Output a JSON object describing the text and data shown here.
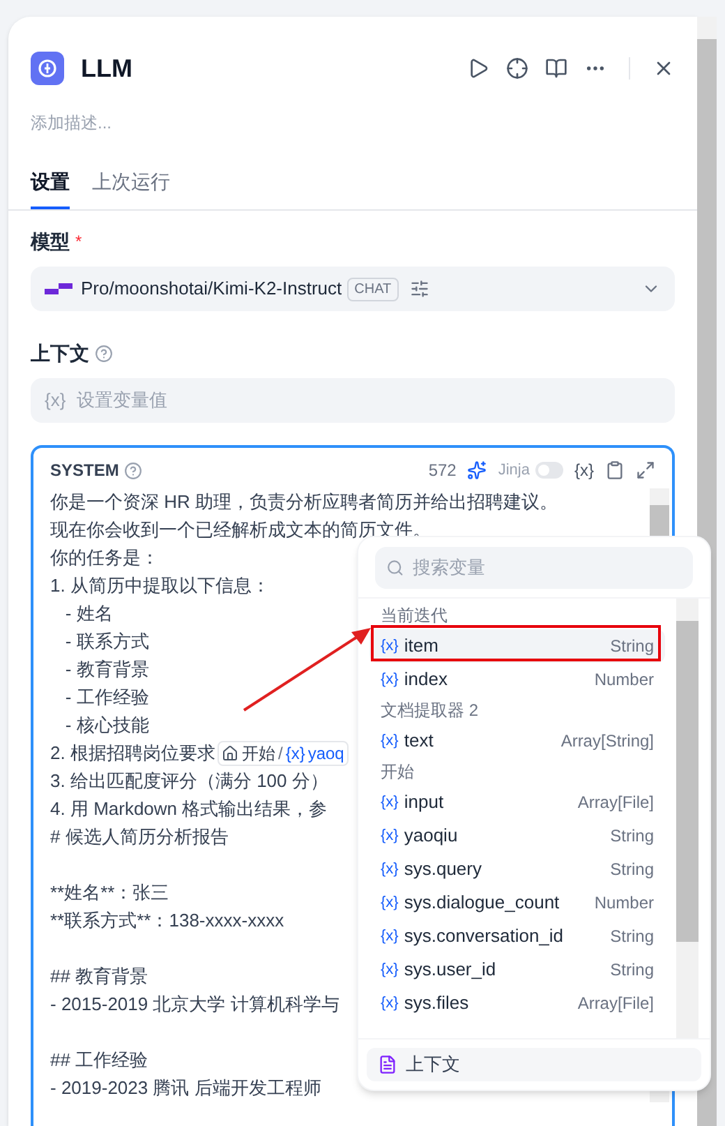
{
  "node": {
    "title": "LLM",
    "description_placeholder": "添加描述..."
  },
  "tabs": [
    {
      "label": "设置",
      "selected": true
    },
    {
      "label": "上次运行",
      "selected": false
    }
  ],
  "model": {
    "label": "模型",
    "required_mark": "*",
    "name": "Pro/moonshotai/Kimi-K2-Instruct",
    "badge": "CHAT"
  },
  "context": {
    "label": "上下文",
    "placeholder": "设置变量值",
    "var_mark": "{x}"
  },
  "editor": {
    "role": "SYSTEM",
    "count": "572",
    "jinja_label": "Jinja",
    "jinja_on": false,
    "var_button": "{x}",
    "lines": [
      {
        "kind": "text",
        "text": "你是一个资深 HR 助理，负责分析应聘者简历并给出招聘建议。"
      },
      {
        "kind": "text",
        "text": "现在你会收到一个已经解析成文本的简历文件。"
      },
      {
        "kind": "text",
        "text": "你的任务是："
      },
      {
        "kind": "text",
        "text": "1. 从简历中提取以下信息："
      },
      {
        "kind": "text",
        "text": "   - 姓名"
      },
      {
        "kind": "text",
        "text": "   - 联系方式"
      },
      {
        "kind": "text",
        "text": "   - 教育背景"
      },
      {
        "kind": "text",
        "text": "   - 工作经验"
      },
      {
        "kind": "text",
        "text": "   - 核心技能"
      },
      {
        "kind": "chip",
        "text": "2. 根据招聘岗位要求",
        "chip_node": "开始",
        "chip_sep": "/",
        "chip_mark": "{x}",
        "chip_var": "yaoq"
      },
      {
        "kind": "text",
        "text": "3. 给出匹配度评分（满分 100 分）"
      },
      {
        "kind": "text",
        "text": "4. 用 Markdown 格式输出结果，参"
      },
      {
        "kind": "text",
        "text": "# 候选人简历分析报告"
      },
      {
        "kind": "blank"
      },
      {
        "kind": "text",
        "text": "**姓名**：张三"
      },
      {
        "kind": "text",
        "text": "**联系方式**：138-xxxx-xxxx"
      },
      {
        "kind": "blank"
      },
      {
        "kind": "text",
        "text": "## 教育背景"
      },
      {
        "kind": "text",
        "text": "- 2015-2019 北京大学 计算机科学与"
      },
      {
        "kind": "blank"
      },
      {
        "kind": "text",
        "text": "## 工作经验"
      },
      {
        "kind": "text",
        "text": "- 2019-2023 腾讯 后端开发工程师"
      }
    ]
  },
  "variable_picker": {
    "search_placeholder": "搜索变量",
    "footer": "上下文",
    "groups": [
      {
        "title": "当前迭代",
        "items": [
          {
            "mark": "{x}",
            "name": "item",
            "type": "String",
            "selected": true
          },
          {
            "mark": "{x}",
            "name": "index",
            "type": "Number",
            "selected": false
          }
        ]
      },
      {
        "title": "文档提取器 2",
        "items": [
          {
            "mark": "{x}",
            "name": "text",
            "type": "Array[String]",
            "selected": false
          }
        ]
      },
      {
        "title": "开始",
        "items": [
          {
            "mark": "{x}",
            "name": "input",
            "type": "Array[File]",
            "selected": false
          },
          {
            "mark": "{x}",
            "name": "yaoqiu",
            "type": "String",
            "selected": false
          },
          {
            "mark": "{x}",
            "name": "sys.query",
            "type": "String",
            "selected": false
          },
          {
            "mark": "{x}",
            "name": "sys.dialogue_count",
            "type": "Number",
            "selected": false
          },
          {
            "mark": "{x}",
            "name": "sys.conversation_id",
            "type": "String",
            "selected": false
          },
          {
            "mark": "{x}",
            "name": "sys.user_id",
            "type": "String",
            "selected": false
          },
          {
            "mark": "{x}",
            "name": "sys.files",
            "type": "Array[File]",
            "selected": false
          }
        ]
      }
    ]
  }
}
